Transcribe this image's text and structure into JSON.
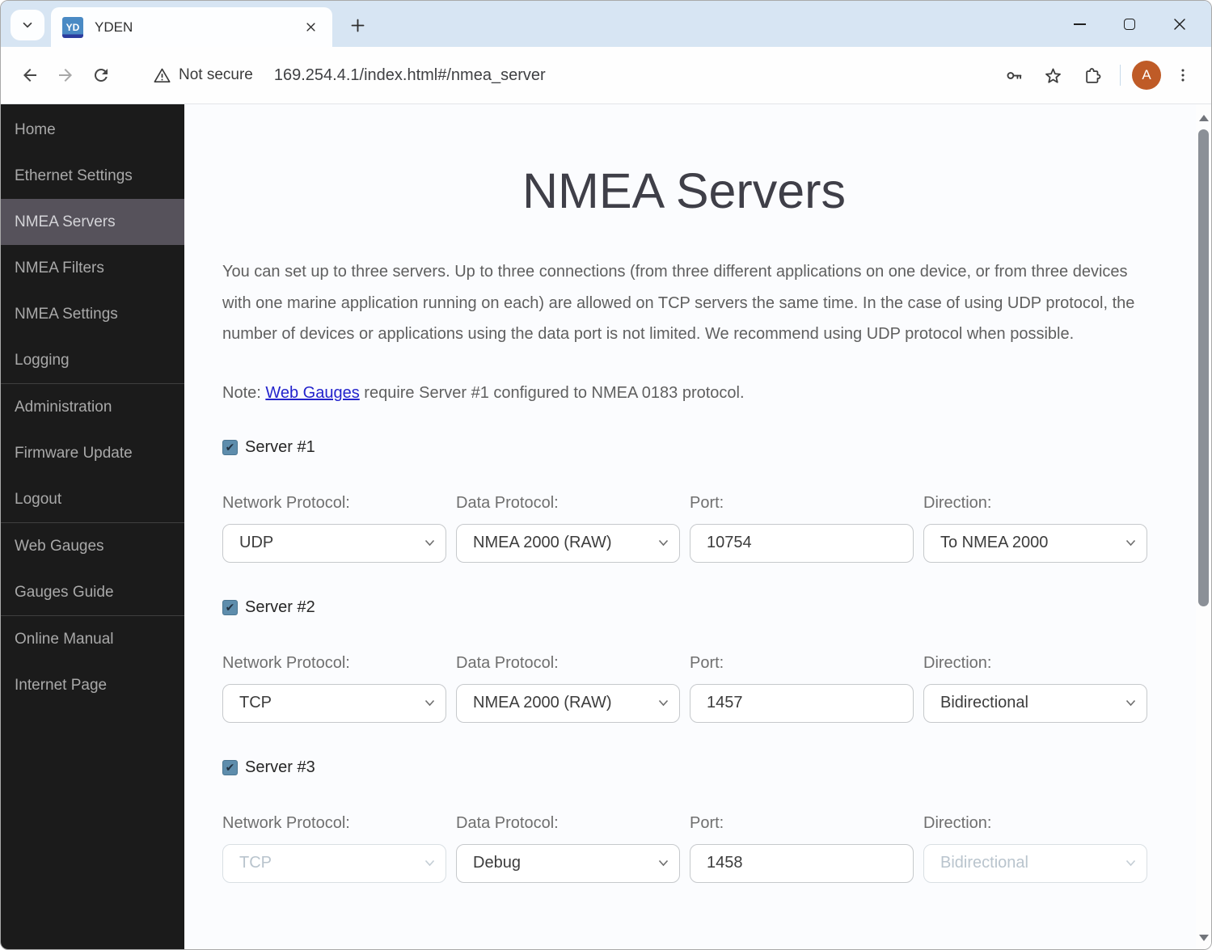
{
  "tabstrip": {
    "tab_title": "YDEN",
    "favicon_text": "YD"
  },
  "toolbar": {
    "security_label": "Not secure",
    "url": "169.254.4.1/index.html#/nmea_server",
    "avatar_letter": "A"
  },
  "sidebar": {
    "items": [
      {
        "label": "Home",
        "active": false
      },
      {
        "label": "Ethernet Settings",
        "active": false
      },
      {
        "label": "NMEA Servers",
        "active": true
      },
      {
        "label": "NMEA Filters",
        "active": false
      },
      {
        "label": "NMEA Settings",
        "active": false
      },
      {
        "label": "Logging",
        "active": false
      },
      {
        "label": "Administration",
        "active": false
      },
      {
        "label": "Firmware Update",
        "active": false
      },
      {
        "label": "Logout",
        "active": false
      },
      {
        "label": "Web Gauges",
        "active": false
      },
      {
        "label": "Gauges Guide",
        "active": false
      },
      {
        "label": "Online Manual",
        "active": false
      },
      {
        "label": "Internet Page",
        "active": false
      }
    ]
  },
  "main": {
    "title": "NMEA Servers",
    "intro": "You can set up to three servers. Up to three connections (from three different applications on one device, or from three devices with one marine application running on each) are allowed on TCP servers the same time. In the case of using UDP protocol, the number of devices or applications using the data port is not limited. We recommend using UDP protocol when possible.",
    "note": {
      "prefix": "Note: ",
      "link_text": "Web Gauges",
      "suffix": " require Server #1 configured to NMEA 0183 protocol."
    },
    "field_labels": {
      "network": "Network Protocol:",
      "data": "Data Protocol:",
      "port": "Port:",
      "direction": "Direction:"
    },
    "servers": [
      {
        "label": "Server #1",
        "checked": true,
        "network_protocol": "UDP",
        "network_disabled": false,
        "data_protocol": "NMEA 2000 (RAW)",
        "port": "10754",
        "direction": "To NMEA 2000",
        "direction_disabled": false
      },
      {
        "label": "Server #2",
        "checked": true,
        "network_protocol": "TCP",
        "network_disabled": false,
        "data_protocol": "NMEA 2000 (RAW)",
        "port": "1457",
        "direction": "Bidirectional",
        "direction_disabled": false
      },
      {
        "label": "Server #3",
        "checked": true,
        "network_protocol": "TCP",
        "network_disabled": true,
        "data_protocol": "Debug",
        "port": "1458",
        "direction": "Bidirectional",
        "direction_disabled": true
      }
    ]
  },
  "colors": {
    "titlebar_bg": "#D7E5F3",
    "sidebar_bg": "#1B1B1B",
    "sidebar_active_bg": "#56525B",
    "link": "#2323CC",
    "checkbox_fill": "#5E8DAC",
    "avatar_bg": "#BF5B27",
    "disabled_text": "#B9C4CD",
    "scrollbar_thumb": "#8B9097"
  }
}
